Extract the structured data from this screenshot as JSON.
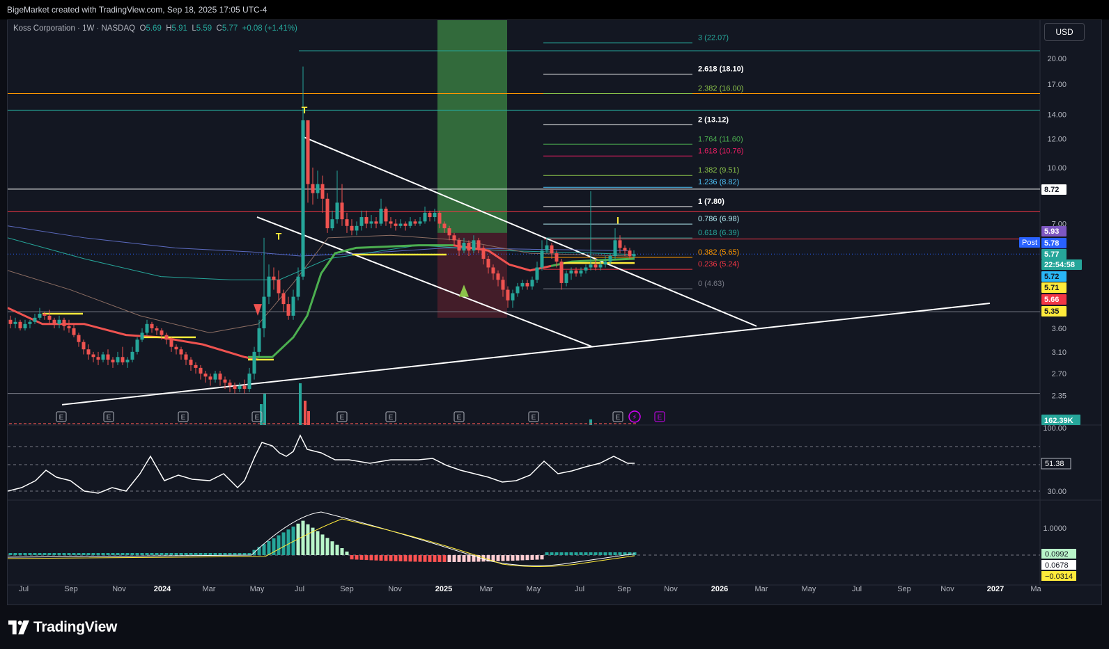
{
  "header": {
    "caption": "BigeMarket created with TradingView.com, Sep 18, 2025 17:05 UTC-4"
  },
  "legend": {
    "symbol": "Koss Corporation · 1W · NASDAQ",
    "o_label": "O",
    "o": "5.69",
    "h_label": "H",
    "h": "5.91",
    "l_label": "L",
    "l": "5.59",
    "c_label": "C",
    "c": "5.77",
    "change": "+0.08 (+1.41%)"
  },
  "currency_button": "USD",
  "footer": {
    "brand": "TradingView"
  },
  "colors": {
    "background": "#131722",
    "up": "#26a69a",
    "down": "#ef5350",
    "fib_orange": "#ff9800",
    "fib_green": "#4caf50",
    "fib_red": "#f23645",
    "fib_blue": "#2962ff"
  },
  "chart_data": {
    "type": "candlestick",
    "title": "Koss Corporation · 1W · NASDAQ",
    "y_scale": "log",
    "price_axis_ticks": [
      "20.00",
      "17.00",
      "14.00",
      "12.00",
      "10.00",
      "7.00",
      "3.60",
      "3.10",
      "2.70",
      "2.35"
    ],
    "time_axis_ticks": [
      "Jul",
      "Sep",
      "Nov",
      "2024",
      "Mar",
      "May",
      "Jul",
      "Sep",
      "Nov",
      "2025",
      "Mar",
      "May",
      "Jul",
      "Sep",
      "Nov",
      "2026",
      "Mar",
      "May",
      "Jul",
      "Sep",
      "Nov",
      "2027",
      "Ma"
    ],
    "bold_time_ticks": [
      "2024",
      "2025",
      "2026",
      "2027"
    ],
    "fib_extension": [
      {
        "ratio": "3",
        "price": "22.07",
        "label": "3 (22.07)",
        "color": "#26a69a"
      },
      {
        "ratio": "2.618",
        "price": "18.10",
        "label": "2.618 (18.10)",
        "color": "#ffffff"
      },
      {
        "ratio": "2.382",
        "price": "16.00",
        "label": "2.382 (16.00)",
        "color": "#8bc34a"
      },
      {
        "ratio": "2",
        "price": "13.12",
        "label": "2 (13.12)",
        "color": "#ffffff"
      },
      {
        "ratio": "1.764",
        "price": "11.60",
        "label": "1.764 (11.60)",
        "color": "#4caf50"
      },
      {
        "ratio": "1.618",
        "price": "10.76",
        "label": "1.618 (10.76)",
        "color": "#e91e63"
      },
      {
        "ratio": "1.382",
        "price": "9.51",
        "label": "1.382 (9.51)",
        "color": "#8bc34a"
      },
      {
        "ratio": "1.236",
        "price": "8.82",
        "label": "1.236 (8.82)",
        "color": "#4fc3f7"
      },
      {
        "ratio": "1",
        "price": "7.80",
        "label": "1 (7.80)",
        "color": "#ffffff"
      },
      {
        "ratio": "0.786",
        "price": "6.98",
        "label": "0.786 (6.98)",
        "color": "#b2ebf2"
      },
      {
        "ratio": "0.618",
        "price": "6.39",
        "label": "0.618 (6.39)",
        "color": "#26a69a"
      },
      {
        "ratio": "0.382",
        "price": "5.65",
        "label": "0.382 (5.65)",
        "color": "#ff9800"
      },
      {
        "ratio": "0.236",
        "price": "5.24",
        "label": "0.236 (5.24)",
        "color": "#f23645"
      },
      {
        "ratio": "0",
        "price": "4.63",
        "label": "0 (4.63)",
        "color": "#787b86"
      }
    ],
    "price_labels": [
      {
        "text": "8.72",
        "bg": "#ffffff",
        "fg": "#131722"
      },
      {
        "text": "5.93",
        "bg": "#7e57c2",
        "fg": "#ffffff"
      },
      {
        "text": "5.78",
        "bg": "#2962ff",
        "fg": "#ffffff"
      },
      {
        "text": "5.77",
        "bg": "#26a69a",
        "fg": "#ffffff"
      },
      {
        "text": "22:54:58",
        "bg": "#26a69a",
        "fg": "#ffffff"
      },
      {
        "text": "5.72",
        "bg": "#29b6f6",
        "fg": "#131722"
      },
      {
        "text": "5.71",
        "bg": "#ffeb3b",
        "fg": "#131722"
      },
      {
        "text": "5.66",
        "bg": "#f23645",
        "fg": "#ffffff"
      },
      {
        "text": "5.35",
        "bg": "#ffeb3b",
        "fg": "#131722"
      }
    ],
    "post_label": "Post",
    "volume_label": "162.39K",
    "markers": [
      "T",
      "T",
      "I"
    ],
    "earnings_marker": "E",
    "rsi": {
      "ticks": [
        "100.00",
        "30.00"
      ],
      "value": "51.38"
    },
    "macd": {
      "ticks": [
        "1.0000"
      ],
      "values": [
        "0.0992",
        "0.0678",
        "−0.0314"
      ]
    }
  }
}
